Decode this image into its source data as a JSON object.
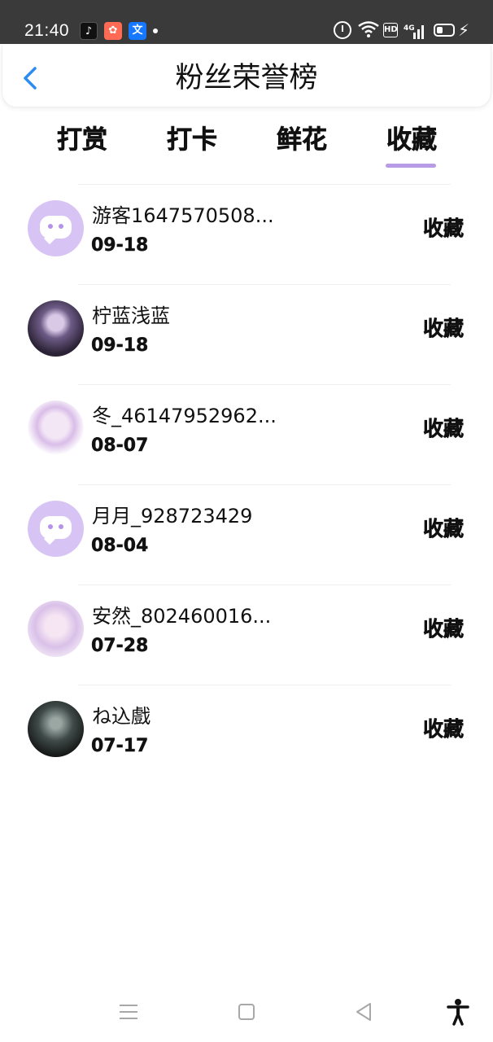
{
  "status_bar": {
    "time": "21:40",
    "app_icons": [
      "tiktok-icon",
      "app-icon",
      "translate-icon"
    ],
    "hd_label": "HD",
    "network_label": "4G"
  },
  "header": {
    "title": "粉丝荣誉榜",
    "back_icon": "chevron-left-icon",
    "accent_color": "#2d8cf0"
  },
  "tabs": {
    "items": [
      {
        "label": "打赏"
      },
      {
        "label": "打卡"
      },
      {
        "label": "鲜花"
      },
      {
        "label": "收藏"
      }
    ],
    "active_index": 3,
    "underline_color": "#b89be6"
  },
  "list": {
    "rows": [
      {
        "name": "游客1647570508...",
        "date": "09-18",
        "action": "收藏",
        "avatar": "default-chat-avatar"
      },
      {
        "name": "柠蓝浅蓝",
        "date": "09-18",
        "action": "收藏",
        "avatar": "user-avatar"
      },
      {
        "name": "冬_46147952962...",
        "date": "08-07",
        "action": "收藏",
        "avatar": "user-avatar"
      },
      {
        "name": "月月_928723429",
        "date": "08-04",
        "action": "收藏",
        "avatar": "default-chat-avatar"
      },
      {
        "name": "安然_802460016...",
        "date": "07-28",
        "action": "收藏",
        "avatar": "user-avatar"
      },
      {
        "name": "ね込戲",
        "date": "07-17",
        "action": "收藏",
        "avatar": "user-avatar"
      }
    ]
  },
  "nav_bar": {
    "icons": [
      "menu-icon",
      "home-icon",
      "back-triangle-icon",
      "accessibility-icon"
    ]
  }
}
